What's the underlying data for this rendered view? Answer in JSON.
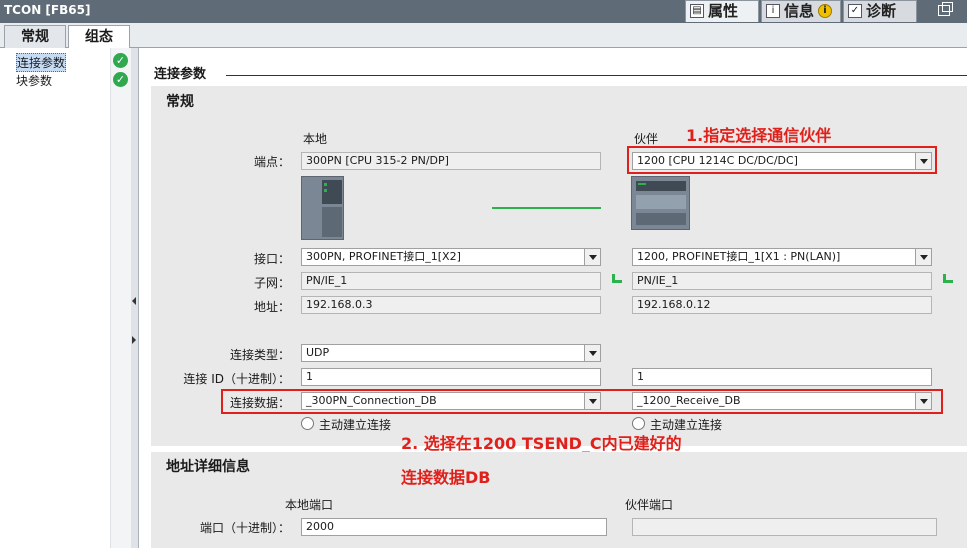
{
  "window": {
    "title": "TCON [FB65]"
  },
  "top_tabs": [
    {
      "label": "属性",
      "icon": "properties-icon"
    },
    {
      "label": "信息",
      "icon": "info-icon",
      "badge": "i"
    },
    {
      "label": "诊断",
      "icon": "diagnostics-icon"
    }
  ],
  "sub_tabs": [
    "常规",
    "组态"
  ],
  "nav": {
    "items": [
      "连接参数",
      "块参数"
    ]
  },
  "section_title": "连接参数",
  "general": {
    "title": "常规",
    "local_header": "本地",
    "partner_header": "伙伴",
    "endpoint": {
      "label": "端点：",
      "local": "300PN [CPU 315-2 PN/DP]",
      "partner": "1200 [CPU 1214C DC/DC/DC]"
    },
    "interface": {
      "label": "接口：",
      "local": "300PN, PROFINET接口_1[X2]",
      "partner": "1200, PROFINET接口_1[X1 : PN(LAN)]"
    },
    "subnet": {
      "label": "子网：",
      "local": "PN/IE_1",
      "partner": "PN/IE_1"
    },
    "address": {
      "label": "地址：",
      "local": "192.168.0.3",
      "partner": "192.168.0.12"
    },
    "connection_type": {
      "label": "连接类型：",
      "value": "UDP"
    },
    "connection_id": {
      "label": "连接 ID（十进制）：",
      "local": "1",
      "partner": "1"
    },
    "connection_data": {
      "label": "连接数据：",
      "local": "_300PN_Connection_DB",
      "partner": "_1200_Receive_DB"
    },
    "active_connect": {
      "local": "主动建立连接",
      "partner": "主动建立连接"
    }
  },
  "address_details": {
    "title": "地址详细信息",
    "local_port_header": "本地端口",
    "partner_port_header": "伙伴端口",
    "port": {
      "label": "端口（十进制）：",
      "local": "2000",
      "partner": ""
    }
  },
  "annotations": {
    "a1": "1.指定选择通信伙伴",
    "a2_line1": "2. 选择在1200 TSEND_C内已建好的",
    "a2_line2": "连接数据DB",
    "color": "#e0201a"
  },
  "colors": {
    "connection_line": "#2bb24c",
    "status_ok": "#2fa84f",
    "titlebar": "#5f6c78"
  }
}
